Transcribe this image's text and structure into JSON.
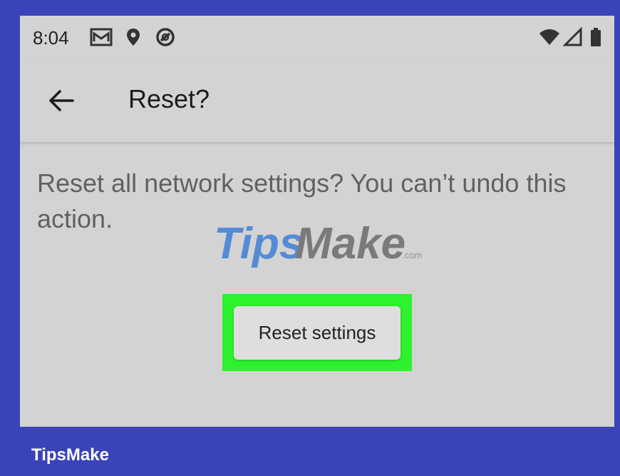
{
  "status_bar": {
    "time": "8:04",
    "left_icons": [
      "gmail-icon",
      "location-pin-icon",
      "sync-icon"
    ],
    "right_icons": [
      "wifi-icon",
      "cell-signal-icon",
      "battery-icon"
    ]
  },
  "app_bar": {
    "back_icon": "arrow-left-icon",
    "title": "Reset?"
  },
  "content": {
    "message": "Reset all network settings? You can’t undo this action.",
    "reset_button_label": "Reset settings",
    "highlight_color": "#2df22d"
  },
  "watermark": {
    "text_part1": "Tips",
    "text_part2": "Make",
    "suffix": ".com"
  },
  "footer": {
    "brand": "TipsMake"
  },
  "colors": {
    "frame": "#3a44b8",
    "screen_background": "#d3d3d3",
    "watermark_blue": "#3f7fd6",
    "watermark_gray": "#6b6b6b"
  }
}
